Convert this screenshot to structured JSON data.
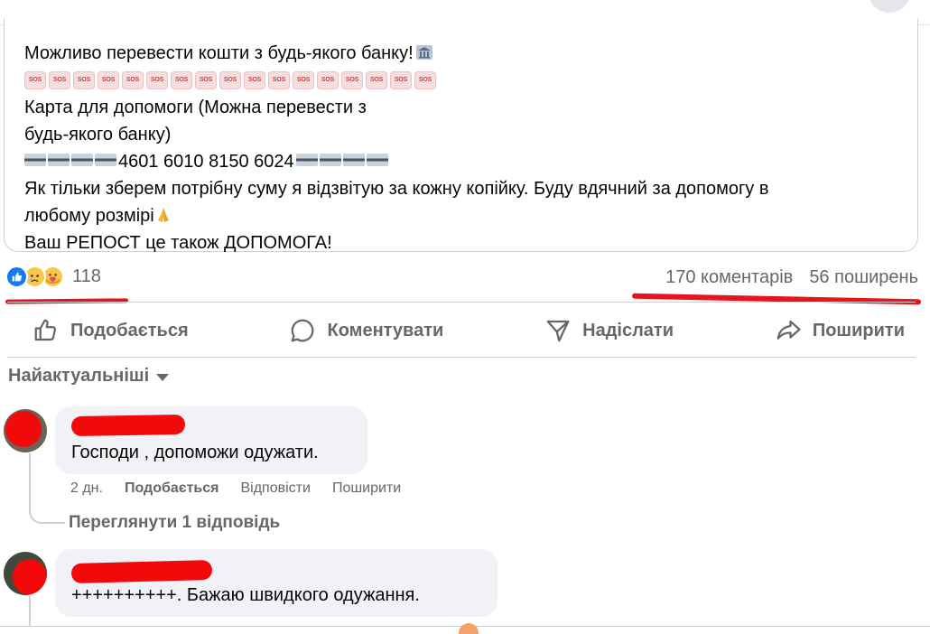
{
  "post": {
    "lines": [
      "Можливо перевести кошти з будь-якого банку!",
      "Карта для допомоги (Можна перевести з",
      "будь-якого банку)",
      "4601 6010 8150 6024",
      "Як тільки зберем потрібну суму я відзвітую за кожну копійку. Буду вдячний за допомогу в",
      "любому розмірі",
      "Ваш РЕПОСТ це також ДОПОМОГА!"
    ],
    "sos_label": "SOS",
    "sos_count": 17,
    "icons": [
      "bank-icon",
      "credit-card-icon",
      "folded-hands-icon"
    ]
  },
  "reactions": {
    "types": [
      "like",
      "sad",
      "care"
    ],
    "count": "118"
  },
  "counts": {
    "comments": "170 коментарів",
    "shares": "56 поширень"
  },
  "actions": {
    "like": "Подобається",
    "comment": "Коментувати",
    "send": "Надіслати",
    "share": "Поширити"
  },
  "comments_filter": "Найактуальніші",
  "comments": [
    {
      "text": "Господи , допоможи одужати.",
      "time": "2 дн.",
      "like": "Подобається",
      "reply": "Відповісти",
      "share": "Поширити",
      "view_replies": "Переглянути 1 відповідь"
    },
    {
      "text": "++++++++++. Бажаю швидкого одужання."
    }
  ],
  "colors": {
    "annotation_red": "#e8141c",
    "secondary_text": "#65676b",
    "bubble_bg": "#f0f2f5",
    "like_blue": "#1877f2"
  }
}
